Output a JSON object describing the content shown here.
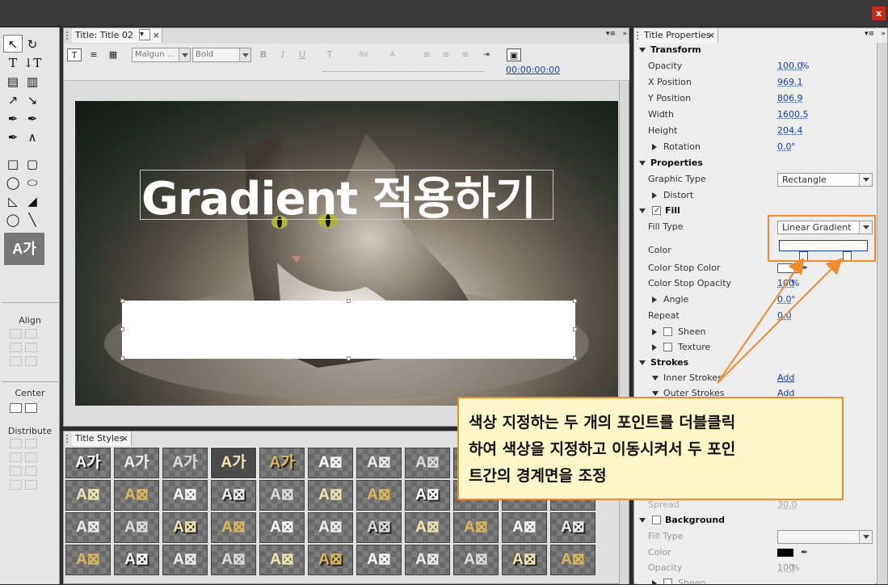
{
  "window": {
    "close_glyph": "x"
  },
  "tools": {
    "rows": [
      [
        "arrow-select",
        "rotate"
      ],
      [
        "T",
        "IT"
      ],
      [
        "area-type",
        "vertical-area-type"
      ],
      [
        "path-type",
        "vertical-path-type"
      ],
      [
        "pen",
        "add-anchor"
      ],
      [
        "delete-anchor",
        "convert-anchor"
      ],
      [
        "rectangle",
        "rounded-rect"
      ],
      [
        "ellipse-rounded",
        "rounded-corner"
      ],
      [
        "wedge",
        "arc"
      ],
      [
        "ellipse",
        "line"
      ]
    ],
    "style_preview": "A가",
    "align_label": "Align",
    "center_label": "Center",
    "distribute_label": "Distribute"
  },
  "editor": {
    "tab_label": "Title: Title 02",
    "font_family": "Malgun ...",
    "font_style": "Bold",
    "timecode": "00:00:00:00",
    "title_text": "Gradient 적용하기"
  },
  "title_styles": {
    "tab_label": "Title Styles",
    "swatches": [
      [
        "A가",
        "A가",
        "A가",
        "A가",
        "A가",
        "A⊠",
        "A⊠",
        "A⊠",
        "",
        "",
        ""
      ],
      [
        "A⊠",
        "A⊠",
        "A⊠",
        "A⊠",
        "A⊠",
        "A⊠",
        "A⊠",
        "A⊠",
        "",
        "",
        ""
      ],
      [
        "A⊠",
        "A⊠",
        "A⊠",
        "A⊠",
        "A⊠",
        "A⊠",
        "A⊠",
        "A⊠",
        "A⊠",
        "A⊠",
        "A⊠"
      ],
      [
        "A⊠",
        "A⊠",
        "A⊠",
        "A⊠",
        "A⊠",
        "A⊠",
        "A⊠",
        "A⊠",
        "A⊠",
        "A⊠",
        "A⊠"
      ]
    ]
  },
  "properties": {
    "tab_label": "Title Properties",
    "transform": "Transform",
    "opacity_label": "Opacity",
    "opacity_val": "100.0",
    "opacity_unit": "%",
    "xpos_label": "X Position",
    "xpos_val": "969.1",
    "ypos_label": "Y Position",
    "ypos_val": "806.9",
    "width_label": "Width",
    "width_val": "1600.5",
    "height_label": "Height",
    "height_val": "204.4",
    "rotation_label": "Rotation",
    "rotation_val": "0.0",
    "degree_unit": "°",
    "properties": "Properties",
    "graphic_type_label": "Graphic Type",
    "graphic_type_val": "Rectangle",
    "distort_label": "Distort",
    "fill": "Fill",
    "fill_type_label": "Fill Type",
    "fill_type_val": "Linear Gradient",
    "color_label": "Color",
    "color_stop_color_label": "Color Stop Color",
    "color_stop_opacity_label": "Color Stop Opacity",
    "color_stop_opacity_val": "100",
    "angle_label": "Angle",
    "angle_val": "0.0",
    "repeat_label": "Repeat",
    "repeat_val": "0.0",
    "sheen_label": "Sheen",
    "texture_label": "Texture",
    "strokes": "Strokes",
    "inner_strokes_label": "Inner Strokes",
    "inner_strokes_val": "Add",
    "outer_strokes_label": "Outer Strokes",
    "outer_strokes_val": "Add",
    "spread_label": "Spread",
    "spread_val": "30.0",
    "background": "Background",
    "bg_fill_type_label": "Fill Type",
    "bg_color_label": "Color",
    "bg_opacity_label": "Opacity",
    "bg_opacity_val": "100",
    "bg_sheen_label": "Sheen"
  },
  "annotation": {
    "line1": "색상 지정하는 두 개의 포인트를 더블클릭",
    "line2": "하여 색상을 지정하고 이동시켜서 두 포인",
    "line3": "트간의 경계면을 조정"
  },
  "colors": {
    "accent": "#f08a2c",
    "link": "#1a3fa8"
  }
}
